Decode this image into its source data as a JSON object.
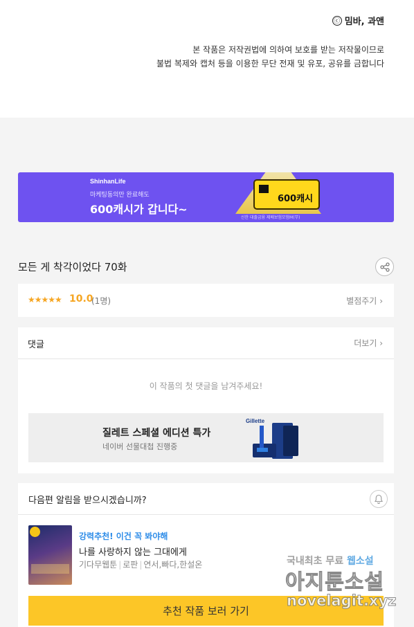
{
  "header": {
    "copyright_label": "밈바, 과앤",
    "copyright_symbol": "ⓒ",
    "notice_line1": "본 작품은 저작권법에 의하여 보호를 받는 저작물이므로",
    "notice_line2": "불법 복제와 캡처 등을 이용한 무단 전재 및 유포, 공유를 금합니다"
  },
  "banner": {
    "brand": "ShinhanLife",
    "sub": "마케팅동의만 완료해도",
    "main": "600캐시가 갑니다~",
    "card_value": "600캐시",
    "fine_print": "신한 대출금융 제배보험모험M(무)",
    "bg_color": "#6e52f0"
  },
  "episode": {
    "title": "모든 게 착각이었다 70화"
  },
  "rating": {
    "stars": "★★★★★",
    "score": "10.0",
    "count": "(1명)",
    "give_label": "별점주기"
  },
  "comments": {
    "label": "댓글",
    "more_label": "더보기",
    "empty_text": "이 작품의 첫 댓글을 남겨주세요!"
  },
  "ad": {
    "title": "질레트 스페셜 에디션 특가",
    "subtitle": "네이버 선물대첩 진행중",
    "brand_mark": "Gillette"
  },
  "next_alert": {
    "question": "다음편 알림을 받으시겠습니까?",
    "tag": "강력추천! 이건 꼭 봐야해",
    "rec_title": "나를 사랑하지 않는 그대에게",
    "meta": [
      "기다무웹툰",
      "로판",
      "연서,빠다,한설온"
    ],
    "button_label": "추천 작품 보러 가기"
  },
  "watermark": {
    "line1": "국내최초 무료 ",
    "line1_highlight": "웹소설",
    "line2": "아지툰소설",
    "line3": "novelagit.xyz"
  },
  "colors": {
    "accent_yellow": "#fcc627",
    "star_orange": "#f6a623",
    "link_blue": "#2d8ce8"
  }
}
